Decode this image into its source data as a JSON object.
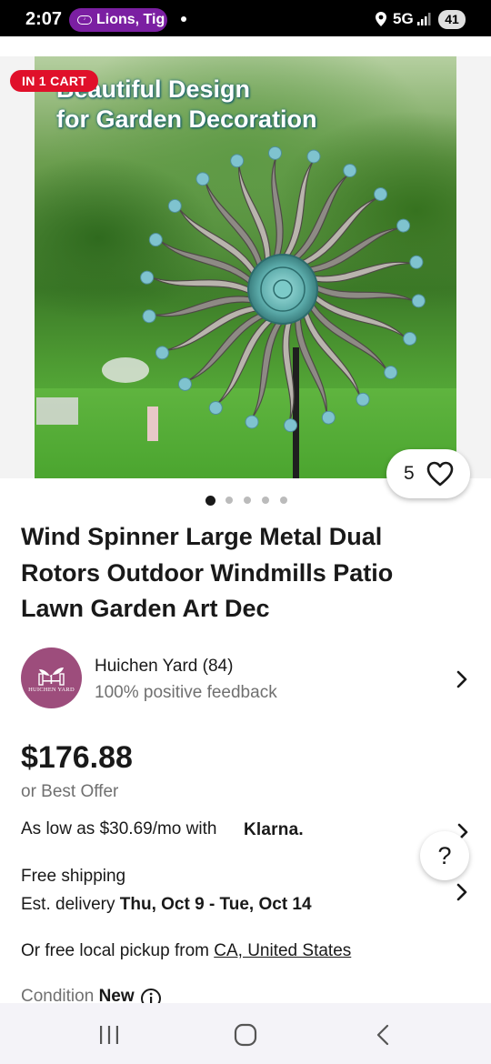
{
  "status_bar": {
    "time": "2:07",
    "notification_pill": "Lions, Tig",
    "network": "5G",
    "battery": "41"
  },
  "hero": {
    "headline_line1": "Beautiful Design",
    "headline_line2": "for Garden Decoration",
    "cart_badge": "IN 1 CART",
    "watch_count": "5",
    "image_count": 5,
    "active_image": 1
  },
  "listing": {
    "title": "Wind Spinner Large Metal Dual Rotors Outdoor Windmills Patio Lawn Garden Art Dec"
  },
  "seller": {
    "name": "Huichen Yard (84)",
    "feedback": "100% positive feedback",
    "avatar_text": "HUICHEN YARD"
  },
  "pricing": {
    "price": "$176.88",
    "best_offer": "or Best Offer",
    "installment": "As low as $30.69/mo with",
    "installment_provider": "Klarna."
  },
  "shipping": {
    "title": "Free shipping",
    "est_label": "Est. delivery",
    "est_dates": "Thu, Oct 9 - Tue, Oct 14"
  },
  "pickup": {
    "text": "Or free local pickup from",
    "location": "CA, United States"
  },
  "condition": {
    "label": "Condition",
    "value": "New"
  },
  "help": {
    "label": "?"
  },
  "colors": {
    "cart_badge": "#e0102a",
    "pill": "#7b1fa2",
    "avatar": "#9d4d7c"
  }
}
